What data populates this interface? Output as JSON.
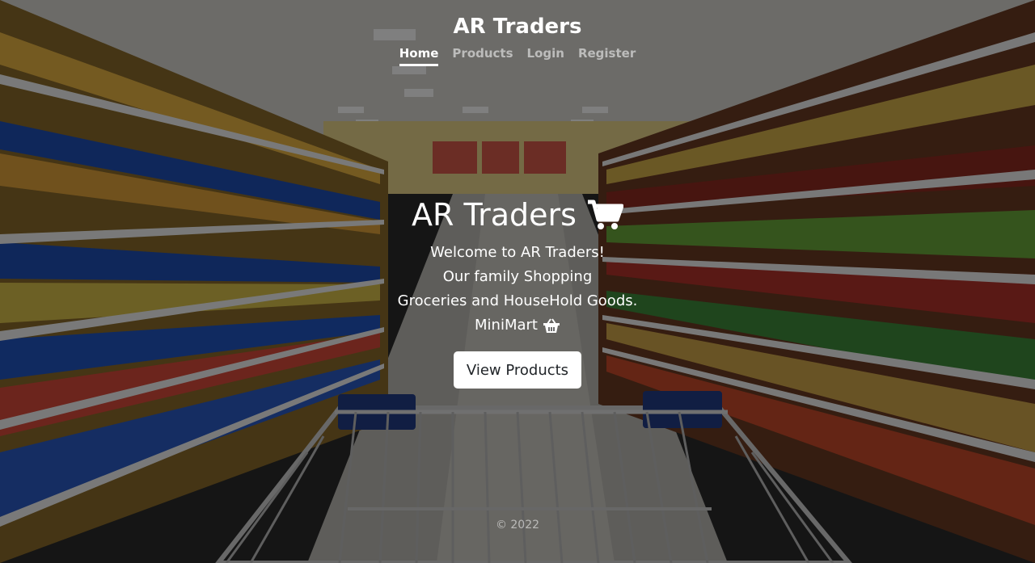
{
  "header": {
    "brand": "AR Traders",
    "nav": [
      {
        "label": "Home",
        "active": true
      },
      {
        "label": "Products",
        "active": false
      },
      {
        "label": "Login",
        "active": false
      },
      {
        "label": "Register",
        "active": false
      }
    ]
  },
  "hero": {
    "title": "AR Traders",
    "title_icon": "shopping-cart-icon",
    "lines": [
      "Welcome to AR Traders!",
      "Our family Shopping",
      "Groceries and HouseHold Goods."
    ],
    "tagline": "MiniMart",
    "tagline_icon": "shopping-basket-icon",
    "cta_label": "View Products"
  },
  "footer": {
    "copyright": "© 2022"
  },
  "colors": {
    "text": "#ffffff",
    "muted_text": "#8c8c8c",
    "button_bg": "#ffffff",
    "button_text": "#212529"
  }
}
